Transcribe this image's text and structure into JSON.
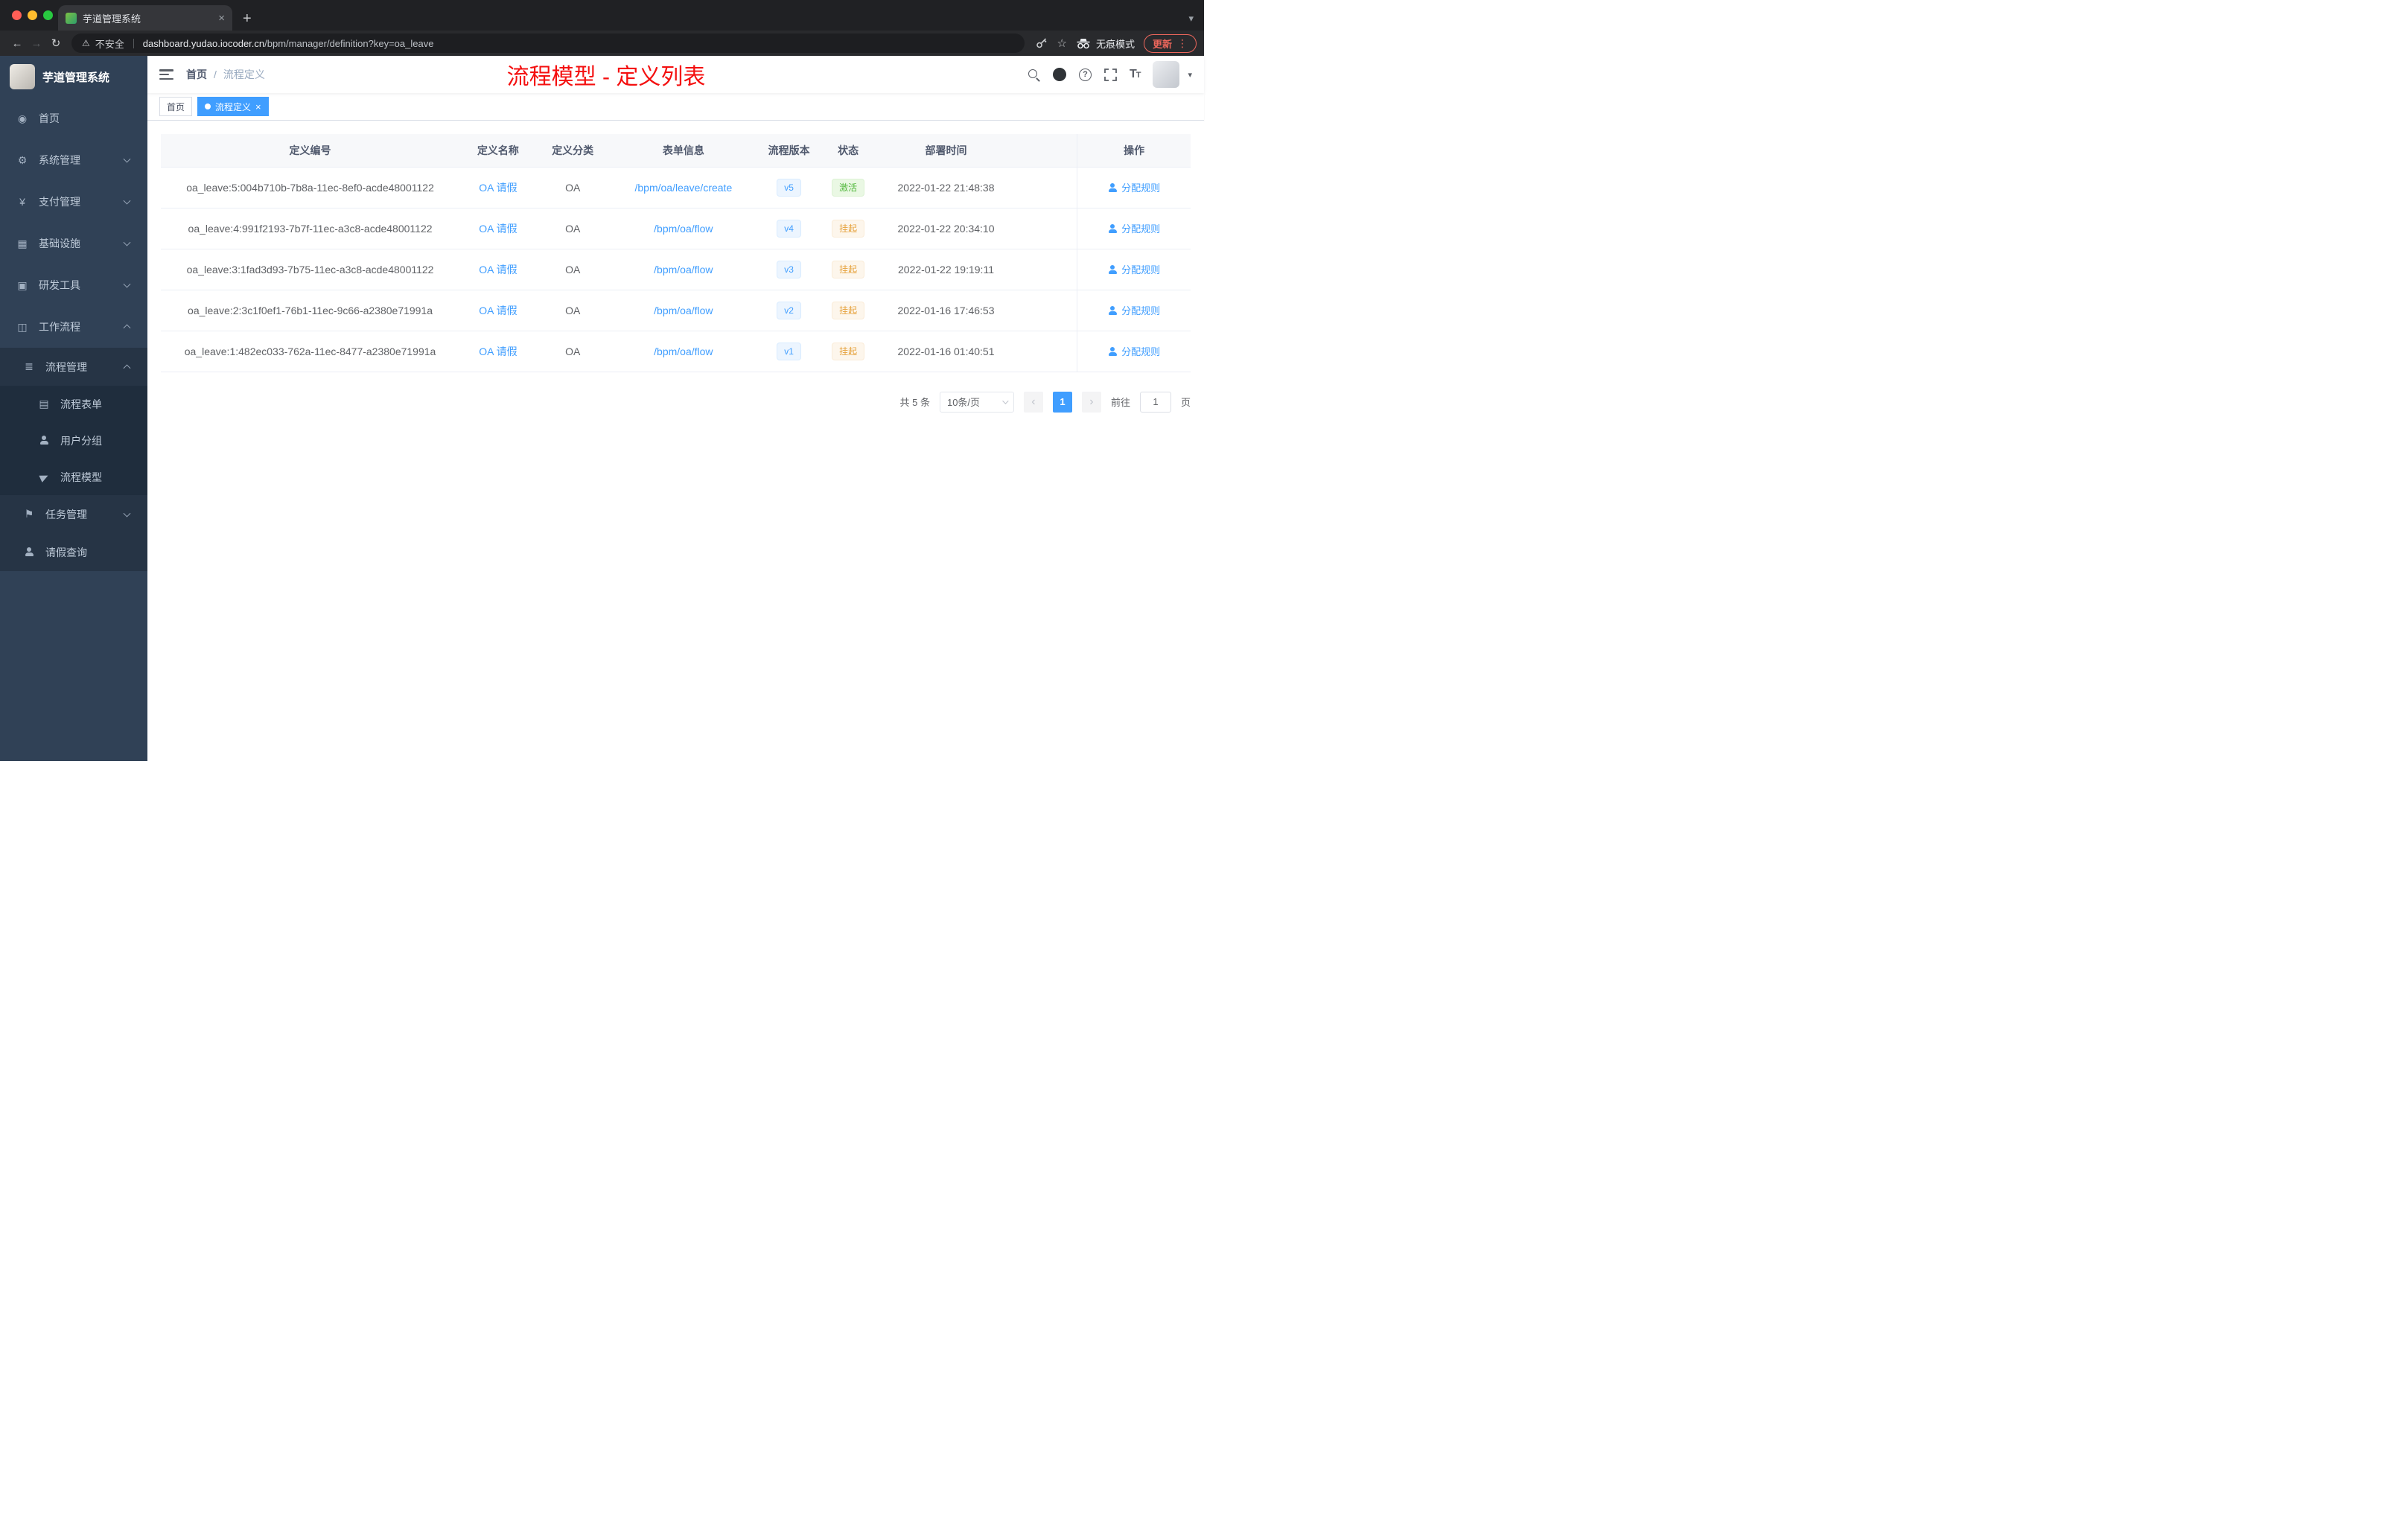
{
  "colors": {
    "accent_blue": "#409eff",
    "annotation_red": "#f40f0f",
    "success_green": "#53b83e",
    "warning_orange": "#e6a23c",
    "sidebar_bg": "#304156",
    "submenu_bg": "#1f2d3d"
  },
  "icons": {
    "close": "×",
    "plus": "+",
    "caret": "▾",
    "tab_search": "▾",
    "kebab": "⋮",
    "back": "←",
    "forward": "→",
    "reload": "↻",
    "warning": "⚠",
    "star": "☆",
    "question": "?",
    "font_size_big": "T",
    "font_size_small": "T",
    "prev": "‹",
    "next": "›",
    "dashboard": "◉",
    "system": "⚙",
    "payment": "¥",
    "infrastructure": "▦",
    "devtools": "▣",
    "workflow": "◫",
    "process_mgmt": "≣",
    "process_form": "▤",
    "task_mgmt": "⚑"
  },
  "browser": {
    "tab_title": "芋道管理系统",
    "security_label": "不安全",
    "url_domain": "dashboard.yudao.iocoder.cn",
    "url_path": "/bpm/manager/definition?key=oa_leave",
    "incognito_label": "无痕模式",
    "update_label": "更新"
  },
  "sidebar": {
    "logo_title": "芋道管理系统",
    "menu": [
      {
        "label": "首页"
      },
      {
        "label": "系统管理"
      },
      {
        "label": "支付管理"
      },
      {
        "label": "基础设施"
      },
      {
        "label": "研发工具"
      },
      {
        "label": "工作流程"
      }
    ],
    "submenu": {
      "process_mgmt": "流程管理",
      "process_form": "流程表单",
      "user_group": "用户分组",
      "process_model": "流程模型",
      "task_mgmt": "任务管理",
      "leave_query": "请假查询"
    }
  },
  "header": {
    "breadcrumb_home": "首页",
    "breadcrumb_sep": "/",
    "breadcrumb_current": "流程定义",
    "annotation_title": "流程模型 - 定义列表"
  },
  "tags": {
    "home": "首页",
    "active": "流程定义"
  },
  "table": {
    "columns": [
      "定义编号",
      "定义名称",
      "定义分类",
      "表单信息",
      "流程版本",
      "状态",
      "部署时间",
      "操作"
    ],
    "action_label": "分配规则",
    "rows": [
      {
        "id": "oa_leave:5:004b710b-7b8a-11ec-8ef0-acde48001122",
        "name": "OA 请假",
        "category": "OA",
        "form": "/bpm/oa/leave/create",
        "version": "v5",
        "status": "激活",
        "time": "2022-01-22 21:48:38"
      },
      {
        "id": "oa_leave:4:991f2193-7b7f-11ec-a3c8-acde48001122",
        "name": "OA 请假",
        "category": "OA",
        "form": "/bpm/oa/flow",
        "version": "v4",
        "status": "挂起",
        "time": "2022-01-22 20:34:10"
      },
      {
        "id": "oa_leave:3:1fad3d93-7b75-11ec-a3c8-acde48001122",
        "name": "OA 请假",
        "category": "OA",
        "form": "/bpm/oa/flow",
        "version": "v3",
        "status": "挂起",
        "time": "2022-01-22 19:19:11"
      },
      {
        "id": "oa_leave:2:3c1f0ef1-76b1-11ec-9c66-a2380e71991a",
        "name": "OA 请假",
        "category": "OA",
        "form": "/bpm/oa/flow",
        "version": "v2",
        "status": "挂起",
        "time": "2022-01-16 17:46:53"
      },
      {
        "id": "oa_leave:1:482ec033-762a-11ec-8477-a2380e71991a",
        "name": "OA 请假",
        "category": "OA",
        "form": "/bpm/oa/flow",
        "version": "v1",
        "status": "挂起",
        "time": "2022-01-16 01:40:51"
      }
    ]
  },
  "pagination": {
    "total": "共 5 条",
    "page_size": "10条/页",
    "page": "1",
    "goto_label": "前往",
    "goto_value": "1",
    "unit_label": "页"
  }
}
